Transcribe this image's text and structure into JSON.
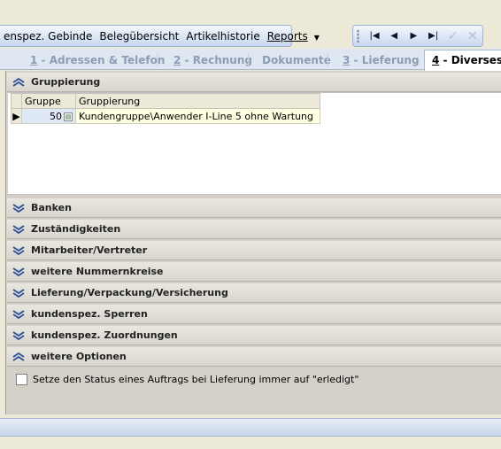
{
  "menubar": {
    "items": [
      "enspez. Gebinde",
      "Belegübersicht",
      "Artikelhistorie",
      "Reports"
    ]
  },
  "navbar": {
    "buttons": [
      "|◀",
      "◀",
      "▶",
      "▶|",
      "✓",
      "✕"
    ]
  },
  "tabs": [
    {
      "number": "1",
      "label": " - Adressen & Telefon"
    },
    {
      "number": "2",
      "label": " - Rechnung"
    },
    {
      "number": "",
      "label": "Dokumente"
    },
    {
      "number": "3",
      "label": " - Lieferung"
    },
    {
      "number": "4",
      "label": " - Diverses"
    }
  ],
  "sections": {
    "gruppierung": "Gruppierung",
    "banken": "Banken",
    "zustaendigkeiten": "Zuständigkeiten",
    "mitarbeiter": "Mitarbeiter/Vertreter",
    "nummernkreise": "weitere Nummernkreise",
    "lieferung": "Lieferung/Verpackung/Versicherung",
    "sperren": "kundenspez. Sperren",
    "zuordnungen": "kundenspez. Zuordnungen",
    "optionen": "weitere Optionen"
  },
  "grid": {
    "columns": [
      "Gruppe",
      "Gruppierung"
    ],
    "rows": [
      {
        "gruppe": "50",
        "gruppierung": "Kundengruppe\\Anwender I-Line 5 ohne Wartung"
      }
    ]
  },
  "options": {
    "status_checkbox_label": "Setze den Status eines Auftrags bei Lieferung immer auf \"erledigt\"",
    "status_checkbox_checked": false
  },
  "colors": {
    "chevron_blue": "#2e4f99",
    "active_tab_text": "#000000",
    "inactive_tab_text": "#8d9db4"
  }
}
